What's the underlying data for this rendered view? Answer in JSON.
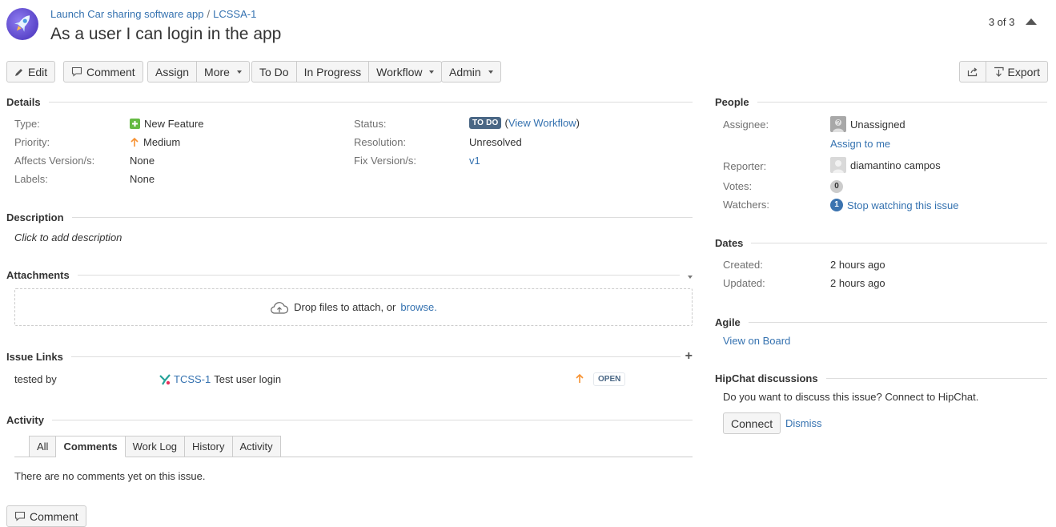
{
  "header": {
    "project": "Launch Car sharing software app",
    "separator": "/",
    "issue_key": "LCSSA-1",
    "title": "As a user I can login in the app",
    "pager": "3 of 3"
  },
  "toolbar": {
    "edit": "Edit",
    "comment": "Comment",
    "assign": "Assign",
    "more": "More",
    "todo": "To Do",
    "in_progress": "In Progress",
    "workflow": "Workflow",
    "admin": "Admin",
    "export": "Export"
  },
  "details": {
    "heading": "Details",
    "type_label": "Type:",
    "type_value": "New Feature",
    "priority_label": "Priority:",
    "priority_value": "Medium",
    "affects_label": "Affects Version/s:",
    "affects_value": "None",
    "labels_label": "Labels:",
    "labels_value": "None",
    "status_label": "Status:",
    "status_value": "TO DO",
    "view_workflow": "View Workflow",
    "resolution_label": "Resolution:",
    "resolution_value": "Unresolved",
    "fix_label": "Fix Version/s:",
    "fix_value": "v1"
  },
  "description": {
    "heading": "Description",
    "placeholder": "Click to add description"
  },
  "attachments": {
    "heading": "Attachments",
    "drop_text": "Drop files to attach, or",
    "browse": "browse."
  },
  "issue_links": {
    "heading": "Issue Links",
    "relation": "tested by",
    "key": "TCSS-1",
    "summary": "Test user login",
    "status": "OPEN"
  },
  "activity": {
    "heading": "Activity",
    "tabs": [
      "All",
      "Comments",
      "Work Log",
      "History",
      "Activity"
    ],
    "empty": "There are no comments yet on this issue.",
    "comment_button": "Comment"
  },
  "people": {
    "heading": "People",
    "assignee_label": "Assignee:",
    "assignee_value": "Unassigned",
    "assign_to_me": "Assign to me",
    "reporter_label": "Reporter:",
    "reporter_value": "diamantino campos",
    "votes_label": "Votes:",
    "votes_value": "0",
    "watchers_label": "Watchers:",
    "watchers_count": "1",
    "watchers_link": "Stop watching this issue"
  },
  "dates": {
    "heading": "Dates",
    "created_label": "Created:",
    "created_value": "2 hours ago",
    "updated_label": "Updated:",
    "updated_value": "2 hours ago"
  },
  "agile": {
    "heading": "Agile",
    "link": "View on Board"
  },
  "hipchat": {
    "heading": "HipChat discussions",
    "text": "Do you want to discuss this issue? Connect to HipChat.",
    "connect": "Connect",
    "dismiss": "Dismiss"
  },
  "colors": {
    "link": "#3572b0",
    "status_lozenge": "#4a6785",
    "priority_arrow": "#f79232",
    "feature_green": "#65ba43"
  }
}
